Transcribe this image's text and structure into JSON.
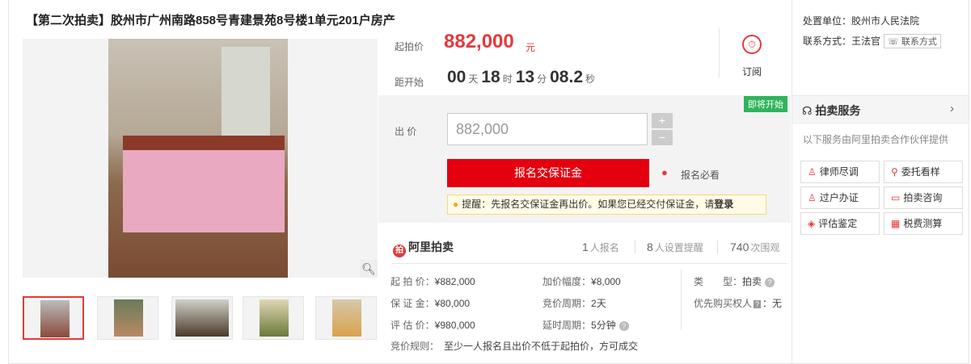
{
  "title": "【第二次拍卖】胶州市广州南路858号青建景苑8号楼1单元201户房产",
  "price": {
    "start_label": "起拍价",
    "start_value": "882,000",
    "start_unit": "元",
    "countdown_label": "距开始",
    "days": "00",
    "days_unit": "天",
    "hours": "18",
    "hours_unit": "时",
    "minutes": "13",
    "minutes_unit": "分",
    "seconds": "08.2",
    "seconds_unit": "秒",
    "subscribe_label": "订阅"
  },
  "bid": {
    "badge": "即将开始",
    "label": "出 价",
    "input_value": "882,000",
    "plus": "+",
    "minus": "−",
    "register_button": "报名交保证金",
    "must_read": "报名必看",
    "tip_text": "提醒：先报名交保证金再出价。如果您已经交付保证金，请",
    "tip_link": "登录"
  },
  "brand": {
    "name": "阿里拍卖",
    "reg_count": "1",
    "reg_label": "人报名",
    "remind_count": "8",
    "remind_label": "人设置提醒",
    "view_count": "740",
    "view_label": "次围观"
  },
  "details": {
    "start_price_k": "起 拍 价：",
    "start_price_v": "¥882,000",
    "increment_k": "加价幅度：",
    "increment_v": "¥8,000",
    "type_k": "类　　型：",
    "type_v": "拍卖",
    "deposit_k": "保 证 金：",
    "deposit_v": "¥80,000",
    "cycle_k": "竞价周期：",
    "cycle_v": "2天",
    "priority_k": "优先购买权人",
    "priority_badge": "?",
    "priority_v": "：无",
    "appraisal_k": "评 估 价：",
    "appraisal_v": "¥980,000",
    "delay_k": "延时周期：",
    "delay_v": "5分钟",
    "rule_k": "竞价规则：",
    "rule_v": "至少一人报名且出价不低于起拍价，方可成交"
  },
  "side": {
    "court_k": "处置单位：",
    "court_v": "胶州市人民法院",
    "contact_k": "联系方式：",
    "contact_v": "王法官",
    "contact_btn": "联系方式",
    "service_title": "拍卖服务",
    "service_sub": "以下服务由阿里拍卖合作伙伴提供",
    "services": [
      "律师尽调",
      "委托看样",
      "过户办证",
      "拍卖咨询",
      "评估鉴定",
      "税费测算"
    ]
  },
  "colors": {
    "accent": "#e4393c",
    "badge_green": "#2fb45a"
  },
  "icons": [
    "zoom-icon",
    "alarm-clock-icon",
    "coins-icon",
    "bulb-icon",
    "headset-icon",
    "chevron-right-icon"
  ]
}
